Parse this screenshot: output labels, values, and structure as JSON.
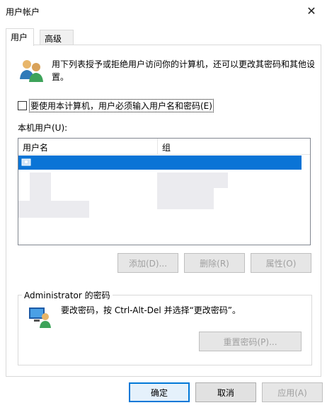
{
  "window": {
    "title": "用户帐户",
    "close_glyph": "✕"
  },
  "tabs": [
    {
      "label": "用户"
    },
    {
      "label": "高级"
    }
  ],
  "intro": {
    "text": "用下列表授予或拒绝用户访问你的计算机，还可以更改其密码和其他设置。"
  },
  "require_login": {
    "label": "要使用本计算机，用户必须输入用户名和密码(E)"
  },
  "users_list": {
    "label": "本机用户(U):",
    "columns": [
      "用户名",
      "组"
    ]
  },
  "list_buttons": {
    "add": "添加(D)...",
    "remove": "删除(R)",
    "properties": "属性(O)"
  },
  "password_group": {
    "title": "Administrator 的密码",
    "text": "要改密码，按 Ctrl-Alt-Del 并选择“更改密码”。",
    "reset_button": "重置密码(P)..."
  },
  "dialog_buttons": {
    "ok": "确定",
    "cancel": "取消",
    "apply": "应用(A)"
  },
  "colors": {
    "selection": "#0a74d6",
    "accent": "#0078d7"
  }
}
